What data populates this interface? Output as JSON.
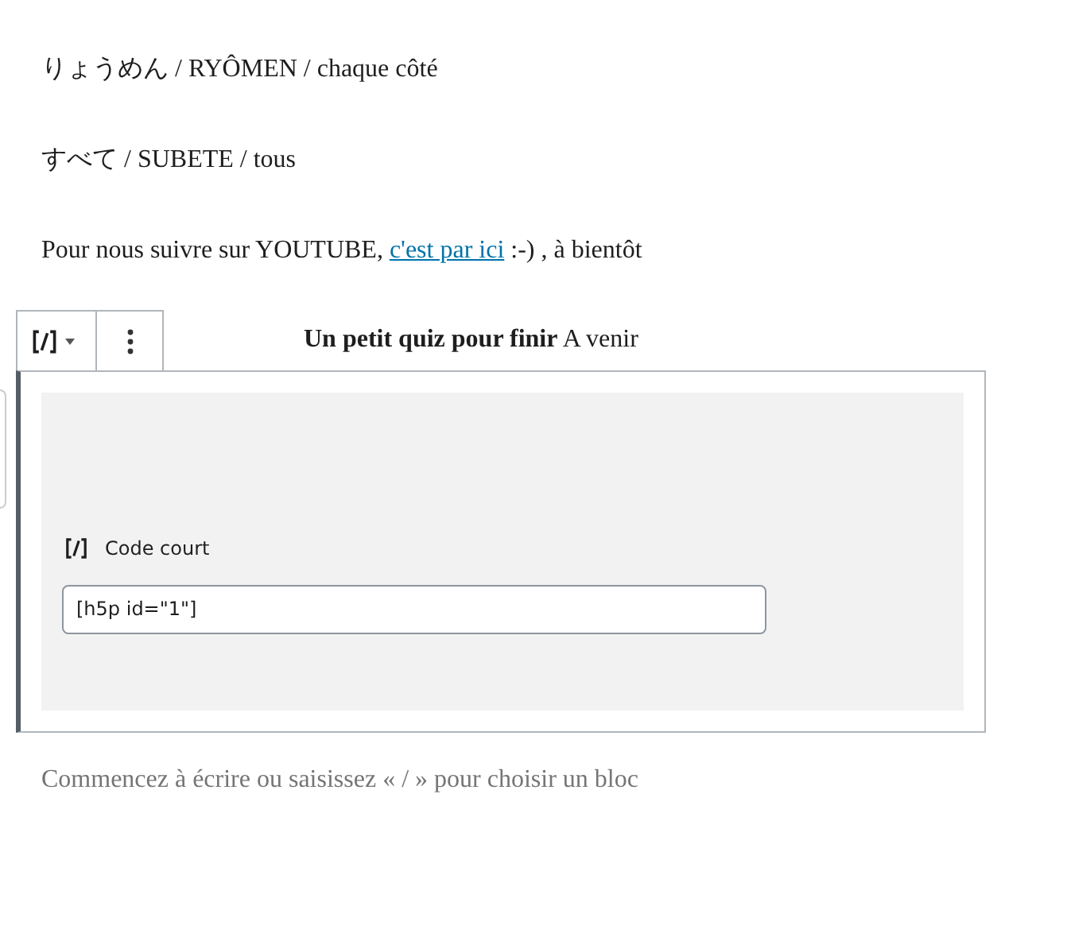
{
  "paragraphs": [
    "りょうめん / RYÔMEN / chaque côté",
    "すべて / SUBETE / tous"
  ],
  "youtube_line": {
    "before": "Pour nous suivre sur YOUTUBE,",
    "link": "c'est par ici",
    "after": ":-) , à bientôt"
  },
  "heading": "**Un petit quiz pour finir** A venir",
  "shortcode_block": {
    "label": "Code court",
    "value": "[h5p id=\"1\"]"
  },
  "appender_placeholder": "Commencez à écrire ou saisissez « / » pour choisir un bloc"
}
